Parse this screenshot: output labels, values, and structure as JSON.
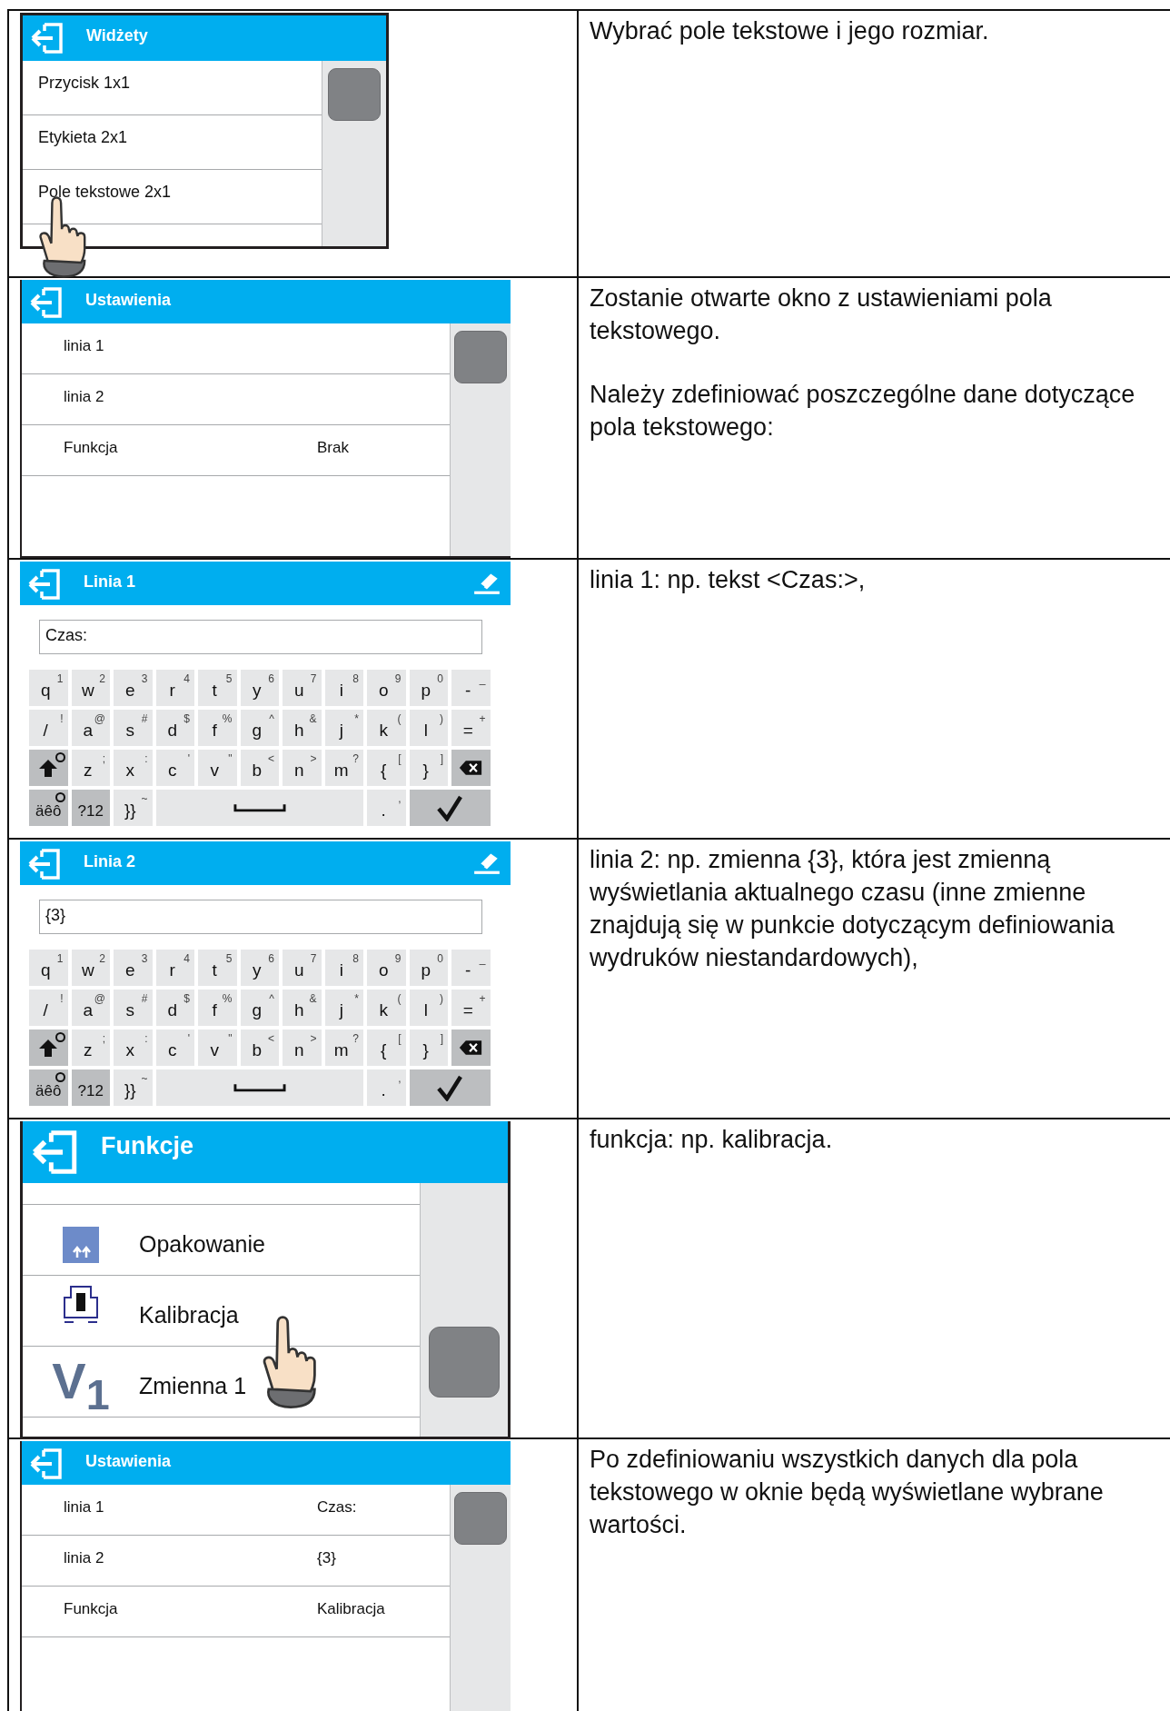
{
  "rows": [
    {
      "screen": {
        "kind": "list",
        "title": "Widżety",
        "pointer": true,
        "items": [
          {
            "label": "Przycisk 1x1"
          },
          {
            "label": "Etykieta 2x1"
          },
          {
            "label": "Pole tekstowe 2x1"
          }
        ]
      },
      "paragraphs": [
        "Wybrać pole tekstowe i jego rozmiar."
      ]
    },
    {
      "screen": {
        "kind": "settings",
        "title": "Ustawienia",
        "items": [
          {
            "label": "linia 1"
          },
          {
            "label": "linia 2"
          },
          {
            "label": "Funkcja",
            "value": "Brak"
          }
        ]
      },
      "paragraphs": [
        "Zostanie otwarte okno z ustawieniami pola tekstowego.",
        "Należy zdefiniować poszczególne dane dotyczące pola tekstowego:"
      ]
    },
    {
      "screen": {
        "kind": "keyboard",
        "title": "Linia 1",
        "value": "Czas:",
        "keys": [
          {
            "main": "q",
            "sub": "1"
          },
          {
            "main": "w",
            "sub": "2"
          },
          {
            "main": "e",
            "sub": "3"
          },
          {
            "main": "r",
            "sub": "4"
          },
          {
            "main": "t",
            "sub": "5"
          },
          {
            "main": "y",
            "sub": "6"
          },
          {
            "main": "u",
            "sub": "7"
          },
          {
            "main": "i",
            "sub": "8"
          },
          {
            "main": "o",
            "sub": "9"
          },
          {
            "main": "p",
            "sub": "0"
          },
          {
            "main": "-",
            "sub": "_"
          },
          {
            "main": "/",
            "sub": "!"
          },
          {
            "main": "a",
            "sub": "@"
          },
          {
            "main": "s",
            "sub": "#"
          },
          {
            "main": "d",
            "sub": "$"
          },
          {
            "main": "f",
            "sub": "%"
          },
          {
            "main": "g",
            "sub": "^"
          },
          {
            "main": "h",
            "sub": "&"
          },
          {
            "main": "j",
            "sub": "*"
          },
          {
            "main": "k",
            "sub": "("
          },
          {
            "main": "l",
            "sub": ")"
          },
          {
            "main": "=",
            "sub": "+"
          },
          {
            "kind": "shift",
            "indicator": true
          },
          {
            "main": "z",
            "sub": ";"
          },
          {
            "main": "x",
            "sub": ":"
          },
          {
            "main": "c",
            "sub": "'"
          },
          {
            "main": "v",
            "sub": "\""
          },
          {
            "main": "b",
            "sub": "<"
          },
          {
            "main": "n",
            "sub": ">"
          },
          {
            "main": "m",
            "sub": "?"
          },
          {
            "main": "{",
            "sub": "["
          },
          {
            "main": "}",
            "sub": "]"
          },
          {
            "kind": "backspace"
          },
          {
            "kind": "mode",
            "main": "äêô",
            "indicator": true
          },
          {
            "kind": "mode",
            "main": "?12"
          },
          {
            "main": "}}",
            "sub": "~"
          },
          {
            "kind": "space"
          },
          {
            "main": ".",
            "sub": ","
          },
          {
            "kind": "enter"
          }
        ]
      },
      "paragraphs": [
        "linia 1: np. tekst <Czas:>,"
      ]
    },
    {
      "screen": {
        "kind": "keyboard",
        "title": "Linia 2",
        "value": "{3}",
        "keys": [
          {
            "main": "q",
            "sub": "1"
          },
          {
            "main": "w",
            "sub": "2"
          },
          {
            "main": "e",
            "sub": "3"
          },
          {
            "main": "r",
            "sub": "4"
          },
          {
            "main": "t",
            "sub": "5"
          },
          {
            "main": "y",
            "sub": "6"
          },
          {
            "main": "u",
            "sub": "7"
          },
          {
            "main": "i",
            "sub": "8"
          },
          {
            "main": "o",
            "sub": "9"
          },
          {
            "main": "p",
            "sub": "0"
          },
          {
            "main": "-",
            "sub": "_"
          },
          {
            "main": "/",
            "sub": "!"
          },
          {
            "main": "a",
            "sub": "@"
          },
          {
            "main": "s",
            "sub": "#"
          },
          {
            "main": "d",
            "sub": "$"
          },
          {
            "main": "f",
            "sub": "%"
          },
          {
            "main": "g",
            "sub": "^"
          },
          {
            "main": "h",
            "sub": "&"
          },
          {
            "main": "j",
            "sub": "*"
          },
          {
            "main": "k",
            "sub": "("
          },
          {
            "main": "l",
            "sub": ")"
          },
          {
            "main": "=",
            "sub": "+"
          },
          {
            "kind": "shift",
            "indicator": true
          },
          {
            "main": "z",
            "sub": ";"
          },
          {
            "main": "x",
            "sub": ":"
          },
          {
            "main": "c",
            "sub": "'"
          },
          {
            "main": "v",
            "sub": "\""
          },
          {
            "main": "b",
            "sub": "<"
          },
          {
            "main": "n",
            "sub": ">"
          },
          {
            "main": "m",
            "sub": "?"
          },
          {
            "main": "{",
            "sub": "["
          },
          {
            "main": "}",
            "sub": "]"
          },
          {
            "kind": "backspace"
          },
          {
            "kind": "mode",
            "main": "äêô",
            "indicator": true
          },
          {
            "kind": "mode",
            "main": "?12"
          },
          {
            "main": "}}",
            "sub": "~"
          },
          {
            "kind": "space"
          },
          {
            "main": ".",
            "sub": ","
          },
          {
            "kind": "enter"
          }
        ]
      },
      "paragraphs": [
        "linia 2: np. zmienna {3}, która jest zmienną wyświetlania aktualnego czasu (inne zmienne znajdują się w punkcie dotyczącym definiowania wydruków niestandardowych),"
      ]
    },
    {
      "screen": {
        "kind": "functions",
        "title": "Funkcje",
        "pointer": true,
        "items": [
          {
            "kind": "tare",
            "label": "Opakowanie"
          },
          {
            "kind": "calibration",
            "label": "Kalibracja"
          },
          {
            "kind": "variable",
            "icon_text": "V$_{1}$",
            "label": "Zmienna 1"
          }
        ]
      },
      "paragraphs": [
        "funkcja: np. kalibracja."
      ]
    },
    {
      "screen": {
        "kind": "settings",
        "title": "Ustawienia",
        "items": [
          {
            "label": "linia 1",
            "value": "Czas:"
          },
          {
            "label": "linia 2",
            "value": "{3}"
          },
          {
            "label": "Funkcja",
            "value": "Kalibracja"
          }
        ]
      },
      "paragraphs": [
        "Po zdefiniowaniu wszystkich danych dla pola tekstowego w oknie będą wyświetlane wybrane wartości."
      ]
    }
  ]
}
